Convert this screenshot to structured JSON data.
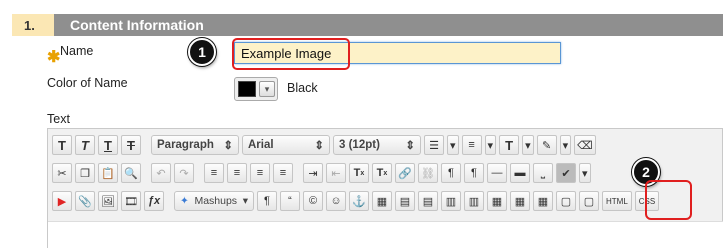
{
  "section": {
    "number": "1.",
    "title": "Content Information"
  },
  "fields": {
    "name_label": "Name",
    "name_value": "Example Image",
    "color_label": "Color of Name",
    "color_value": "Black",
    "text_label": "Text"
  },
  "callouts": {
    "first": "1",
    "second": "2"
  },
  "toolbar": {
    "row1": {
      "format_bold_icon": "T",
      "format_italic_icon": "T",
      "format_underline_icon": "T",
      "format_strike_icon": "T",
      "paragraph_select": "Paragraph",
      "font_select": "Arial",
      "size_select": "3 (12pt)"
    },
    "row2": {
      "superscript_label": "T",
      "subscript_label": "T"
    },
    "row3": {
      "mashups_label": "Mashups",
      "html_label": "HTML",
      "css_label": "CSS",
      "quote_label": "“",
      "copyright_label": "©",
      "paragraph_mark": "¶"
    }
  },
  "colors": {
    "accent_red": "#e01f1f",
    "header_gray": "#8f8f8f",
    "header_number_bg": "#fbe7b4",
    "input_bg": "#fdf2c8"
  }
}
